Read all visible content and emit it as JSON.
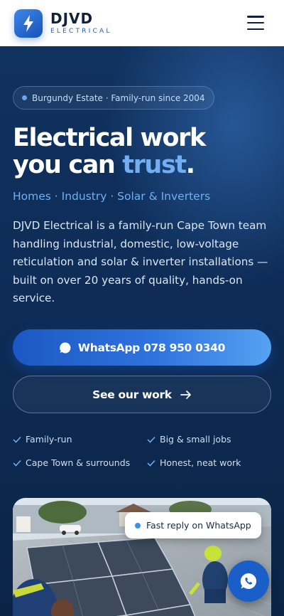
{
  "brand": {
    "name": "DJVD",
    "subtitle": "ELECTRICAL"
  },
  "header": {
    "menu_icon": "hamburger-menu-icon",
    "logo_icon": "lightning-bolt-icon"
  },
  "hero": {
    "pill_text": "Burgundy Estate · Family-run since 2004",
    "headline_line1": "Electrical work",
    "headline_line2_prefix": "you can ",
    "headline_accent": "trust",
    "headline_suffix": ".",
    "tagline": "Homes · Industry · Solar & Inverters",
    "description": "DJVD Electrical is a family-run Cape Town team handling industrial, domestic, low-voltage reticulation and solar & inverter installations — built on over 20 years of quality, hands-on service.",
    "primary_button": {
      "label": "WhatsApp 078 950 0340",
      "icon": "whatsapp-chat-icon"
    },
    "secondary_button": {
      "label": "See our work",
      "icon": "arrow-right-icon"
    },
    "features": [
      "Family-run",
      "Big & small jobs",
      "Cape Town & surrounds",
      "Honest, neat work"
    ],
    "toast_text": "Fast reply on WhatsApp"
  },
  "colors": {
    "accent": "#73aef0",
    "primary": "#1c58c4",
    "hero_bg": "#0e2c56",
    "header_bg": "#ffffff"
  }
}
